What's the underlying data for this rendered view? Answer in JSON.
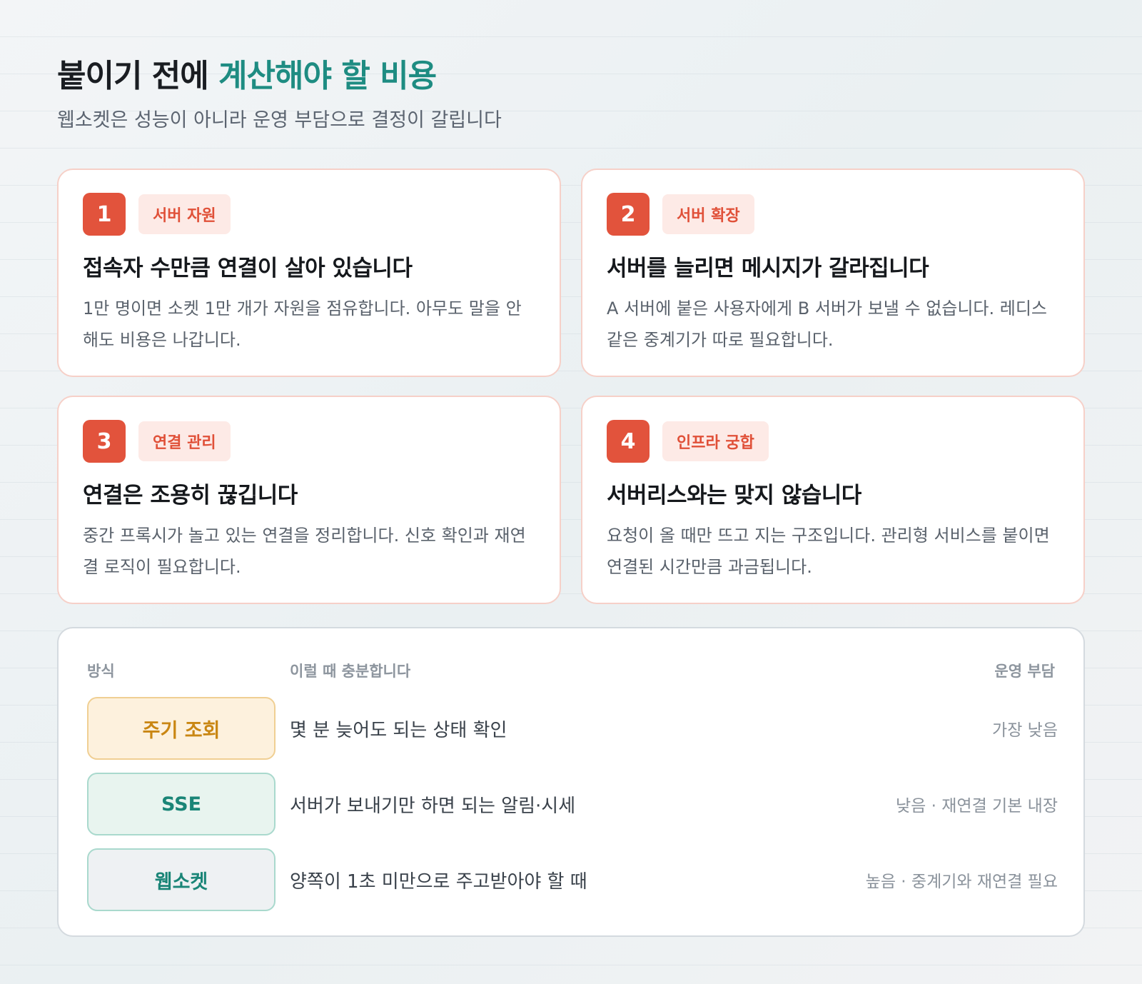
{
  "header": {
    "title_plain": "붙이기 전에 ",
    "title_accent": "계산해야 할 비용",
    "subtitle": "웹소켓은 성능이 아니라 운영 부담으로 결정이 갈립니다"
  },
  "cards": [
    {
      "number": "1",
      "tag": "서버 자원",
      "title": "접속자 수만큼 연결이 살아 있습니다",
      "body": "1만 명이면 소켓 1만 개가 자원을 점유합니다. 아무도 말을 안 해도 비용은 나갑니다."
    },
    {
      "number": "2",
      "tag": "서버 확장",
      "title": "서버를 늘리면 메시지가 갈라집니다",
      "body": "A 서버에 붙은 사용자에게 B 서버가 보낼 수 없습니다. 레디스 같은 중계기가 따로 필요합니다."
    },
    {
      "number": "3",
      "tag": "연결 관리",
      "title": "연결은 조용히 끊깁니다",
      "body": "중간 프록시가 놀고 있는 연결을 정리합니다. 신호 확인과 재연결 로직이 필요합니다."
    },
    {
      "number": "4",
      "tag": "인프라 궁합",
      "title": "서버리스와는 맞지 않습니다",
      "body": "요청이 올 때만 뜨고 지는 구조입니다. 관리형 서비스를 붙이면 연결된 시간만큼 과금됩니다."
    }
  ],
  "comparison": {
    "headers": {
      "method": "방식",
      "when": "이럴 때 충분합니다",
      "burden": "운영 부담"
    },
    "rows": [
      {
        "method": "주기 조회",
        "when": "몇 분 늦어도 되는 상태 확인",
        "burden": "가장 낮음"
      },
      {
        "method": "SSE",
        "when": "서버가 보내기만 하면 되는 알림·시세",
        "burden": "낮음 · 재연결 기본 내장"
      },
      {
        "method": "웹소켓",
        "when": "양쪽이 1초 미만으로 주고받아야 할 때",
        "burden": "높음 · 중계기와 재연결 필요"
      }
    ]
  }
}
